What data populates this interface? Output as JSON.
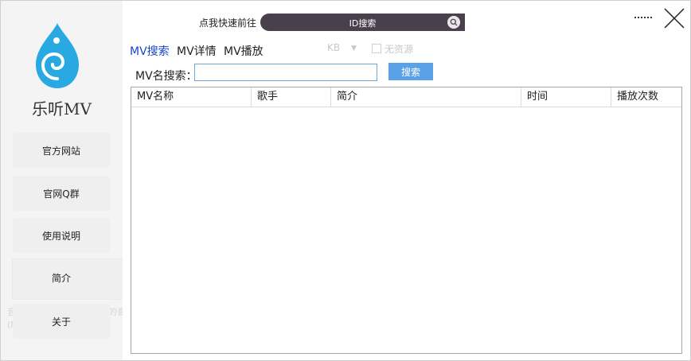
{
  "sidebar": {
    "brand": "乐听MV",
    "items": [
      {
        "label": "官方网站"
      },
      {
        "label": "官网Q群"
      },
      {
        "label": "使用说明"
      },
      {
        "label": "简介"
      },
      {
        "label": "关于"
      }
    ],
    "background_ghost_text": [
      "音乐MV，满足了不同用户的音乐需求，同时也由于歌",
      "(MB)."
    ]
  },
  "topbar": {
    "quick_label": "点我快速前往",
    "quick_button": "ID搜索",
    "quick_icon": "search-icon",
    "minimize_icon": "minimize-icon",
    "close_icon": "close-icon"
  },
  "tabs": [
    {
      "label": "MV搜索",
      "active": true
    },
    {
      "label": "MV详情",
      "active": false
    },
    {
      "label": "MV播放",
      "active": false
    }
  ],
  "faded": {
    "kb": "KB",
    "arrow": "▼",
    "no_source": "无资源"
  },
  "search": {
    "label": "MV名搜索：",
    "value": "",
    "button": "搜索"
  },
  "table": {
    "columns": [
      "MV名称",
      "歌手",
      "简介",
      "时间",
      "播放次数"
    ],
    "rows": []
  },
  "colors": {
    "accent": "#5aa1e7",
    "active_tab": "#1a44c9",
    "logo": "#29a9e1",
    "quick_bar": "#4a3f4d"
  }
}
